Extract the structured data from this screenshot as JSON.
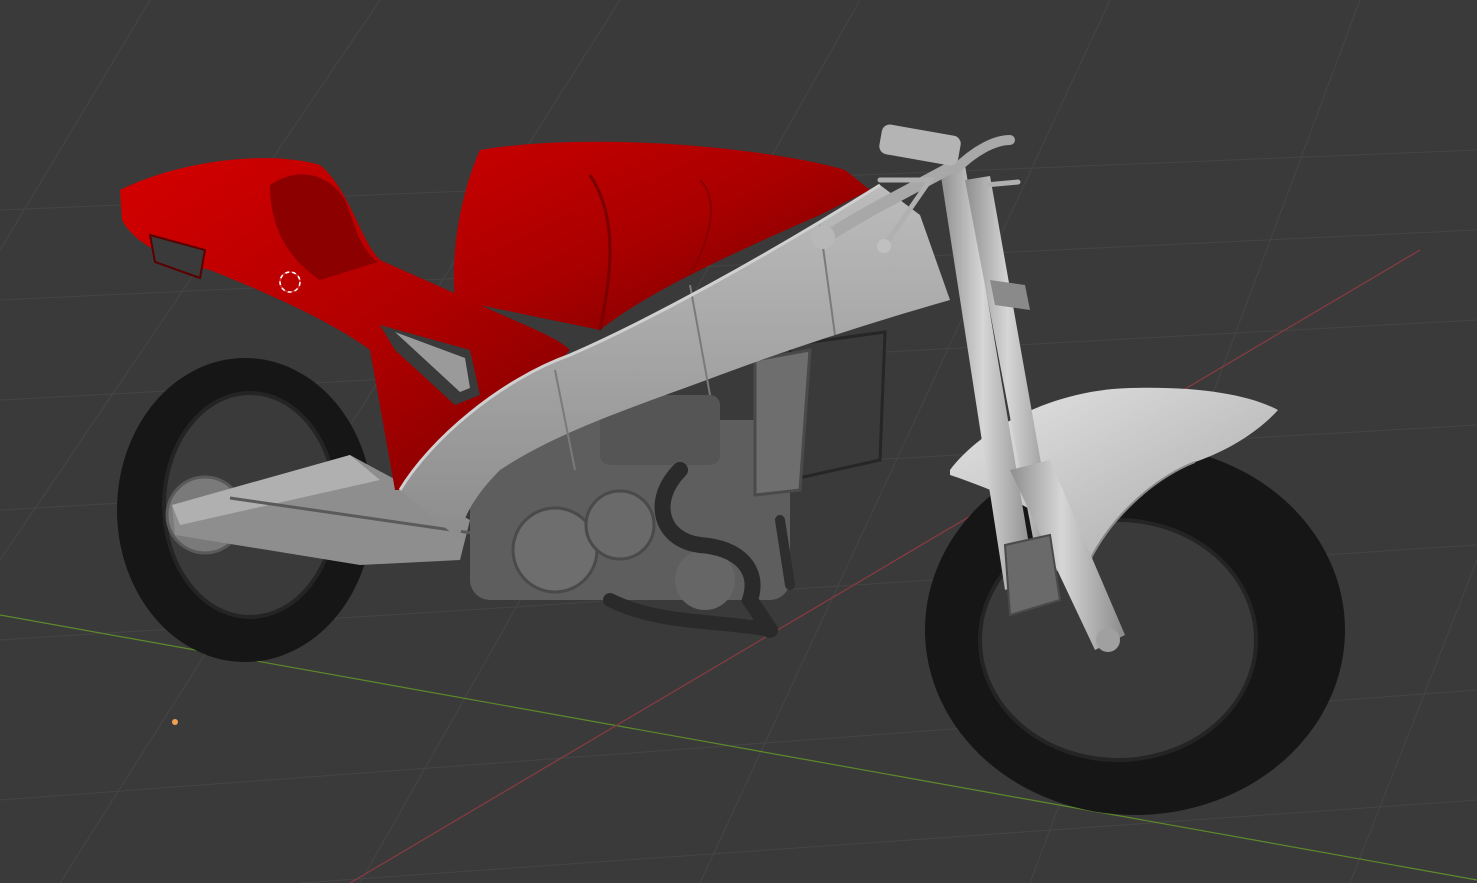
{
  "viewport": {
    "mode": "3D Viewport",
    "shading": "solid"
  },
  "scene": {
    "object": "motorcycle",
    "colors": {
      "background": "#3a3a3a",
      "grid_line": "#454545",
      "x_axis": "#8a3a42",
      "y_axis": "#5d8a2a",
      "fairing_red": "#c40000",
      "fairing_red_dark": "#8c0000",
      "frame_gray": "#a6a6a6",
      "tire": "#161616",
      "engine": "#5e5e5e",
      "origin_dot": "#f0a050"
    }
  },
  "icons": {
    "cursor": "3d-cursor-icon",
    "origin": "object-origin-icon"
  }
}
